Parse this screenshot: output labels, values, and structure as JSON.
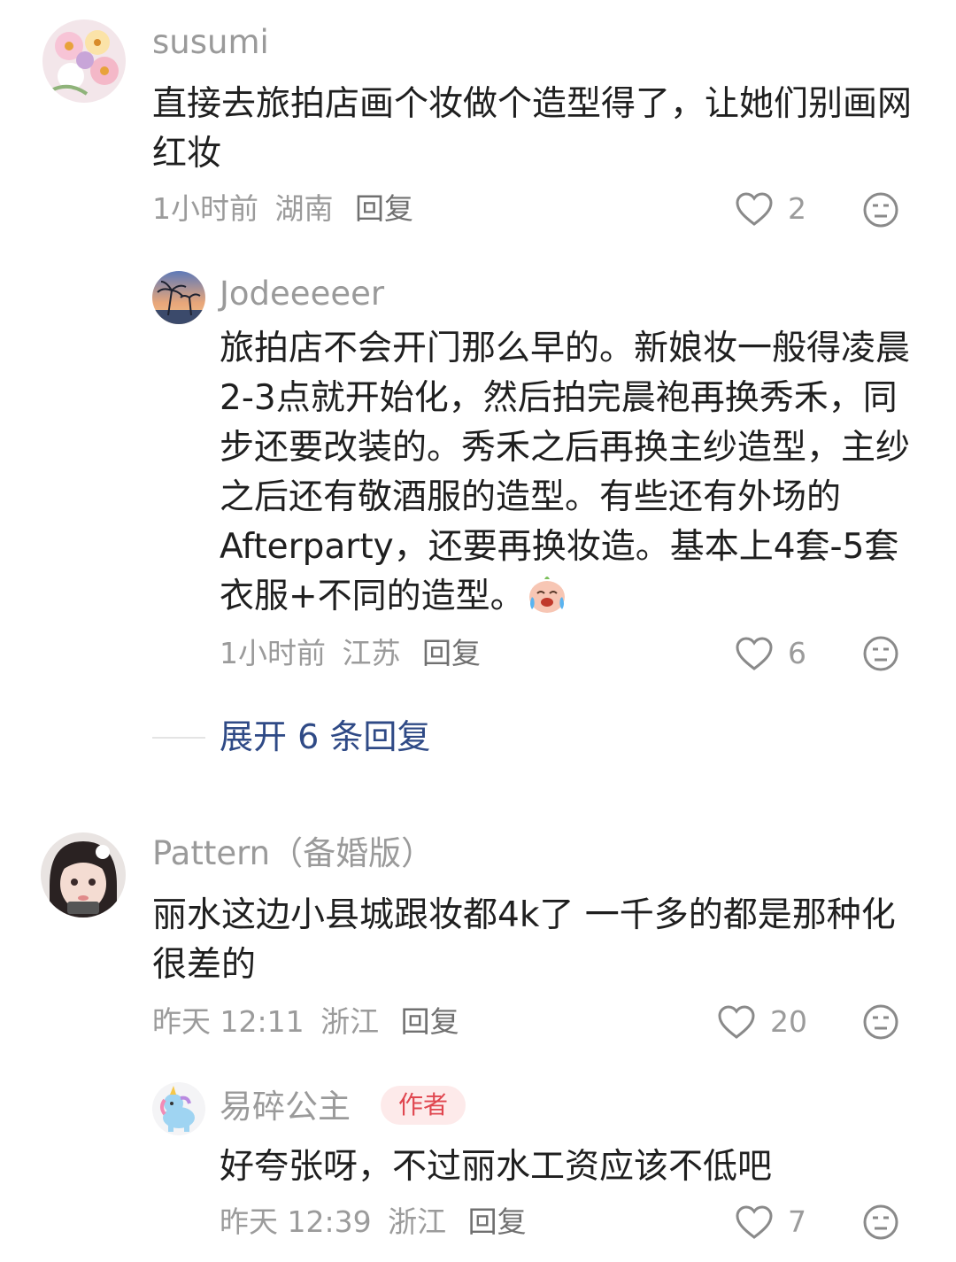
{
  "comments": [
    {
      "username": "susumi",
      "text": "直接去旅拍店画个妆做个造型得了，让她们别画网红妆",
      "time": "1小时前",
      "location": "湖南",
      "reply_label": "回复",
      "likes": "2"
    },
    {
      "username": "Jodeeeeer",
      "text": "旅拍店不会开门那么早的。新娘妆一般得凌晨2-3点就开始化，然后拍完晨袍再换秀禾，同步还要改装的。秀禾之后再换主纱造型，主纱之后还有敬酒服的造型。有些还有外场的Afterparty，还要再换妆造。基本上4套-5套衣服+不同的造型。",
      "emoji": "crying-laugh",
      "time": "1小时前",
      "location": "江苏",
      "reply_label": "回复",
      "likes": "6"
    },
    {
      "username": "Pattern（备婚版）",
      "text": "丽水这边小县城跟妆都4k了 一千多的都是那种化很差的",
      "time": "昨天 12:11",
      "location": "浙江",
      "reply_label": "回复",
      "likes": "20"
    },
    {
      "username": "易碎公主",
      "badge": "作者",
      "text": "好夸张呀，不过丽水工资应该不低吧",
      "time": "昨天 12:39",
      "location": "浙江",
      "reply_label": "回复",
      "likes": "7"
    }
  ],
  "expand_replies": "展开 6 条回复",
  "colors": {
    "username": "#9a9a9a",
    "text": "#1f1f1f",
    "link": "#2f4a86",
    "badge_bg": "#fdeaea",
    "badge_text": "#e0464f"
  }
}
